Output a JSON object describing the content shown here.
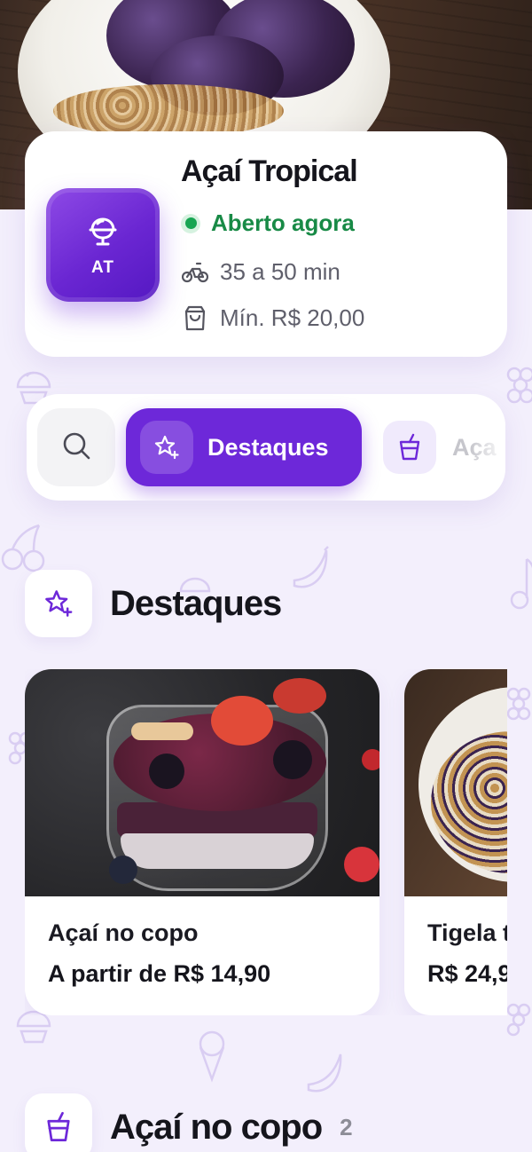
{
  "store": {
    "name": "Açaí Tropical",
    "logo_abbr": "AT",
    "status": "Aberto agora",
    "delivery_time": "35 a 50 min",
    "min_order": "Mín. R$ 20,00",
    "status_color": "#17a552",
    "brand_color": "#6d28d9"
  },
  "category_nav": {
    "search_icon": "search-icon",
    "tabs": [
      {
        "label": "Destaques",
        "icon": "star-sparkle-icon",
        "active": true
      },
      {
        "label": "Aça",
        "icon": "cup-icon",
        "active": false
      }
    ]
  },
  "sections": [
    {
      "title": "Destaques",
      "icon": "star-sparkle-icon",
      "products": [
        {
          "name": "Açaí no copo",
          "price": "A partir de R$ 14,90"
        },
        {
          "name": "Tigela t",
          "price": "R$ 24,9"
        }
      ]
    },
    {
      "title": "Açaí no copo",
      "icon": "cup-icon",
      "count": "2"
    }
  ]
}
